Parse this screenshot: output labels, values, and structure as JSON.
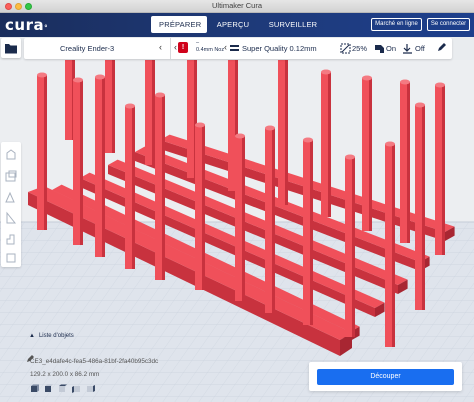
{
  "window": {
    "title": "Ultimaker Cura"
  },
  "header": {
    "logo": "cura",
    "tabs": [
      {
        "label": "PRÉPARER",
        "active": true
      },
      {
        "label": "APERÇU",
        "active": false
      },
      {
        "label": "SURVEILLER",
        "active": false
      }
    ],
    "marketplace_label": "Marché en ligne",
    "signin_label": "Se connecter"
  },
  "toolbar": {
    "printer_name": "Creality Ender-3",
    "extruder_top": "–",
    "extruder_nozzle": "0.4mm Noz",
    "profile": "Super Quality 0.12mm",
    "infill": "25%",
    "support": "On",
    "adhesion": "Off",
    "icons": [
      "folder-icon",
      "chevron-left-icon",
      "material-warning-icon",
      "profile-icon",
      "infill-icon",
      "support-icon",
      "adhesion-icon",
      "edit-icon"
    ]
  },
  "sidebar_tools": [
    "move-tool-icon",
    "scale-tool-icon",
    "rotate-tool-icon",
    "mirror-tool-icon",
    "per-model-settings-icon",
    "support-blocker-icon"
  ],
  "object_list": {
    "header": "Liste d'objets",
    "object_name": "CE3_e4dafe4c-fea5-486a-81bf-2fa40b95c3dc",
    "dimensions": "129.2 x 200.0 x 86.2 mm"
  },
  "slice": {
    "button_label": "Découper"
  },
  "colors": {
    "model": "#f0505a",
    "header": "#1e3a7a",
    "accent": "#196ef0"
  }
}
